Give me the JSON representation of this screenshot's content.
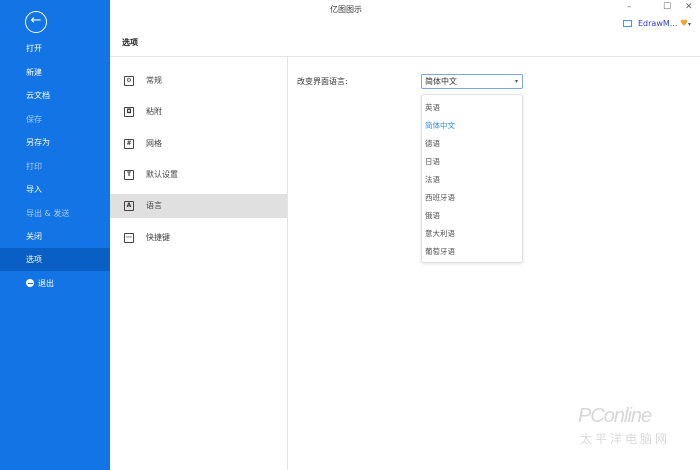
{
  "window": {
    "title": "亿图图示",
    "minimize": "–",
    "maximize": "☐",
    "close": "✕",
    "user": "EdrawM...",
    "user_arrow": "▾"
  },
  "sidebar": {
    "back": "←",
    "items": [
      {
        "label": "打开"
      },
      {
        "label": "新建"
      },
      {
        "label": "云文档"
      },
      {
        "label": "保存"
      },
      {
        "label": "另存为"
      },
      {
        "label": "打印"
      },
      {
        "label": "导入"
      },
      {
        "label": "导出 & 发送"
      },
      {
        "label": "关闭"
      },
      {
        "label": "选项"
      },
      {
        "label": "退出"
      }
    ]
  },
  "header": {
    "title": "选项"
  },
  "options_menu": [
    {
      "label": "常规",
      "icon": "⚙"
    },
    {
      "label": "粘附",
      "icon": "◘"
    },
    {
      "label": "网格",
      "icon": "#"
    },
    {
      "label": "默认设置",
      "icon": "T"
    },
    {
      "label": "语言",
      "icon": "A"
    },
    {
      "label": "快捷键",
      "icon": "⋯"
    }
  ],
  "language": {
    "label": "改变界面语言:",
    "selected": "简体中文",
    "arrow": "▾",
    "options": [
      "英语",
      "简体中文",
      "德语",
      "日语",
      "法语",
      "西班牙语",
      "俄语",
      "意大利语",
      "葡萄牙语"
    ]
  },
  "watermark": {
    "brand": "PConline",
    "cn": "太平洋电脑网"
  },
  "colors": {
    "sidebar": "#1374e6",
    "selected_option": "#2d8cf0"
  }
}
